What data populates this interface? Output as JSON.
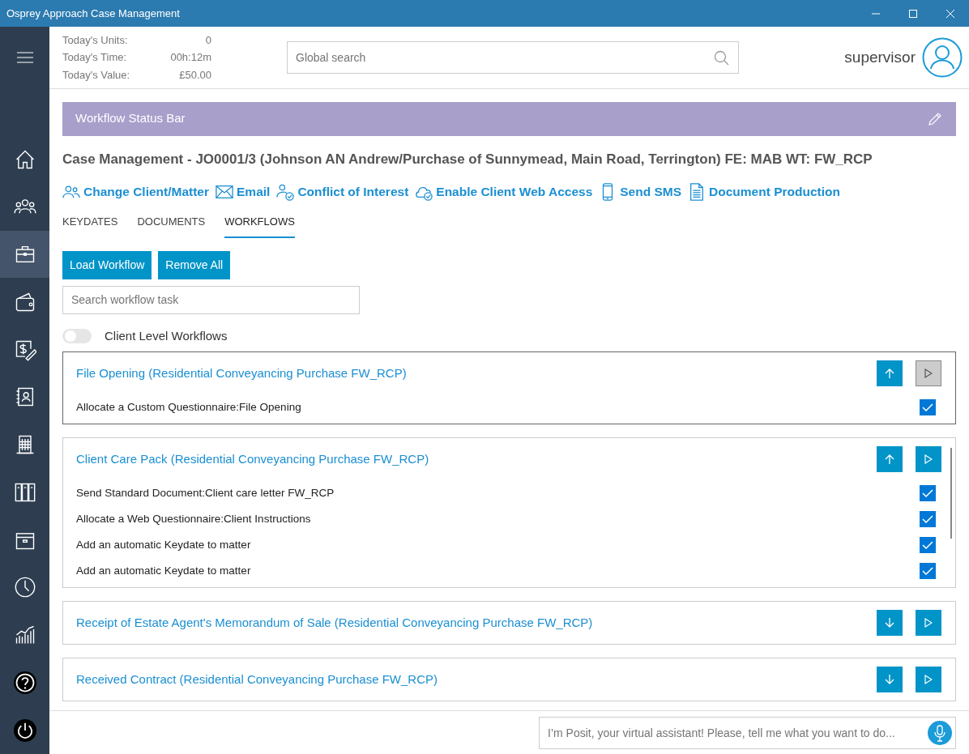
{
  "window": {
    "title": "Osprey Approach Case Management"
  },
  "sidebar": {
    "items": [
      {
        "kind": "home",
        "selected": false
      },
      {
        "kind": "people",
        "selected": false
      },
      {
        "kind": "briefcase",
        "selected": true
      },
      {
        "kind": "wallet",
        "selected": false
      },
      {
        "kind": "billing",
        "selected": false
      },
      {
        "kind": "contacts",
        "selected": false
      },
      {
        "kind": "building",
        "selected": false
      },
      {
        "kind": "binders",
        "selected": false
      },
      {
        "kind": "archive",
        "selected": false
      },
      {
        "kind": "clock",
        "selected": false
      },
      {
        "kind": "chart",
        "selected": false
      },
      {
        "kind": "help",
        "selected": false
      },
      {
        "kind": "power",
        "selected": false
      }
    ]
  },
  "stats": [
    {
      "label": "Today's Units:",
      "value": "0"
    },
    {
      "label": "Today's Time:",
      "value": "00h:12m"
    },
    {
      "label": "Today's Value:",
      "value": "£50.00"
    }
  ],
  "search": {
    "placeholder": "Global search"
  },
  "user": {
    "name": "supervisor"
  },
  "status_bar": {
    "title": "Workflow Status Bar"
  },
  "case_title": "Case Management - JO0001/3 (Johnson AN Andrew/Purchase of Sunnymead, Main Road, Terrington) FE: MAB WT: FW_RCP",
  "actions": [
    {
      "kind": "client",
      "label": "Change Client/Matter"
    },
    {
      "kind": "email",
      "label": "Email"
    },
    {
      "kind": "conflict",
      "label": "Conflict of Interest"
    },
    {
      "kind": "web",
      "label": "Enable Client Web Access"
    },
    {
      "kind": "sms",
      "label": "Send SMS"
    },
    {
      "kind": "document",
      "label": "Document Production"
    }
  ],
  "tabs": [
    {
      "label": "KEYDATES",
      "selected": false
    },
    {
      "label": "DOCUMENTS",
      "selected": false
    },
    {
      "label": "WORKFLOWS",
      "selected": true
    }
  ],
  "buttons": [
    "Load Workflow",
    "Remove All"
  ],
  "task_search": {
    "placeholder": "Search workflow task"
  },
  "toggle": {
    "label": "Client Level Workflows",
    "on": false
  },
  "workflows": [
    {
      "title": "File Opening (Residential Conveyancing Purchase FW_RCP)",
      "selected": true,
      "expanded": true,
      "tasks": [
        {
          "label": "Allocate a Custom Questionnaire:File Opening",
          "checked": true
        }
      ]
    },
    {
      "title": "Client Care Pack (Residential Conveyancing Purchase FW_RCP)",
      "selected": false,
      "expanded": true,
      "tasks": [
        {
          "label": "Send Standard Document:Client care letter FW_RCP",
          "checked": true
        },
        {
          "label": "Allocate a Web Questionnaire:Client Instructions",
          "checked": true
        },
        {
          "label": "Add an automatic Keydate to matter",
          "checked": true
        },
        {
          "label": "Add an automatic Keydate to matter",
          "checked": true
        }
      ]
    },
    {
      "title": "Receipt of Estate Agent's Memorandum of Sale (Residential Conveyancing Purchase FW_RCP)",
      "selected": false,
      "expanded": false
    },
    {
      "title": "Received Contract (Residential Conveyancing Purchase FW_RCP)",
      "selected": false,
      "expanded": false
    }
  ],
  "assistant": {
    "placeholder": "I’m Posit, your virtual assistant! Please, tell me what you want to do..."
  }
}
